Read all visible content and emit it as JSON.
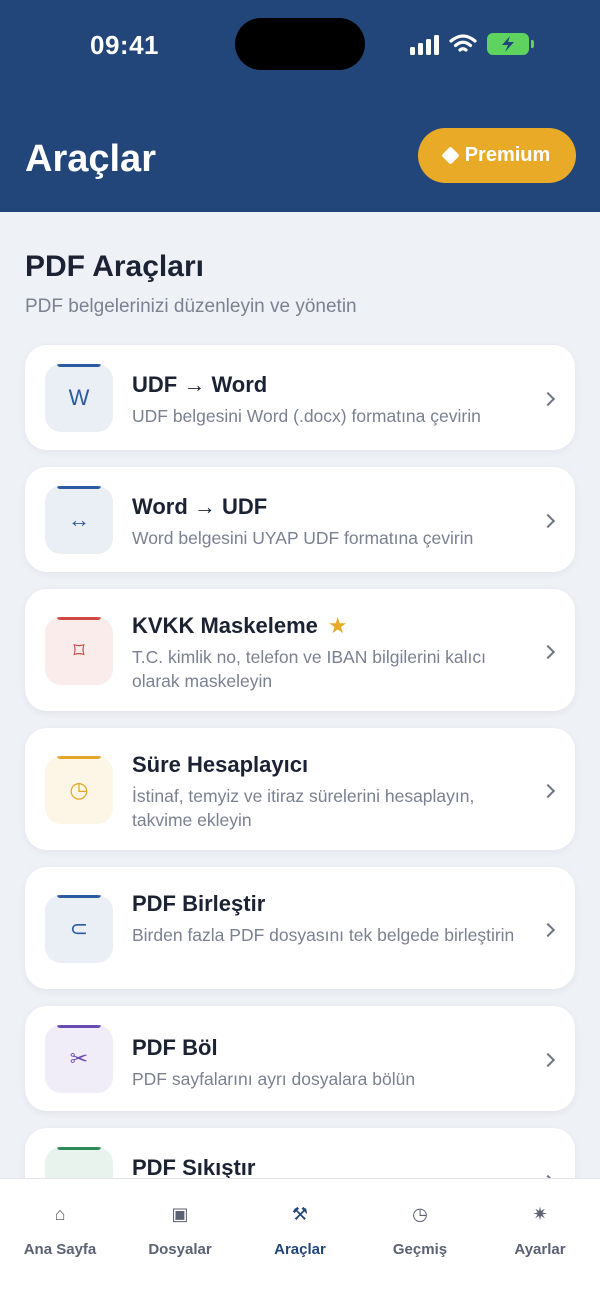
{
  "status_bar": {
    "time": "09:41"
  },
  "header": {
    "title": "Araçlar",
    "premium_label": "Premium"
  },
  "section": {
    "title": "PDF Araçları",
    "subtitle": "PDF belgelerinizi düzenleyin ve yönetin"
  },
  "tools": [
    {
      "title": "UDF → Word",
      "description": "UDF belgesini Word (.docx) formatına çevirin",
      "icon": "word-icon",
      "glyph": "W",
      "accent": "#2c5aa0",
      "icon_bg": "#eaeef5"
    },
    {
      "title": "Word → UDF",
      "description": "Word belgesini UYAP UDF formatına çevirin",
      "icon": "convert-arrows-icon",
      "glyph": "↔",
      "accent": "#2c5aa0",
      "icon_bg": "#eaeef5"
    },
    {
      "title": "KVKK Maskeleme",
      "description": "T.C. kimlik no, telefon ve IBAN bilgilerini kalıcı olarak maskeleyin",
      "icon": "mask-icon",
      "glyph": "⌑",
      "accent": "#d04a43",
      "icon_bg": "#fbecec",
      "starred": true
    },
    {
      "title": "Süre Hesaplayıcı",
      "description": "İstinaf, temyiz ve itiraz sürelerini hesaplayın, takvime ekleyin",
      "icon": "clock-icon",
      "glyph": "◷",
      "accent": "#e3a52a",
      "icon_bg": "#fdf6e6"
    },
    {
      "title": "PDF Birleştir",
      "description": "Birden fazla PDF dosyasını tek belgede birleştirin",
      "icon": "merge-icon",
      "glyph": "⊂",
      "accent": "#2c5aa0",
      "icon_bg": "#eaeef5"
    },
    {
      "title": "PDF Böl",
      "description": "PDF sayfalarını ayrı dosyalara bölün",
      "icon": "scissors-icon",
      "glyph": "✂",
      "accent": "#6a4bb0",
      "icon_bg": "#f0ecf8"
    },
    {
      "title": "PDF Sıkıştır",
      "description": "",
      "icon": "compress-icon",
      "glyph": "▭",
      "accent": "#2f8a5a",
      "icon_bg": "#e8f3ed"
    }
  ],
  "tabbar": {
    "items": [
      {
        "label": "Ana Sayfa",
        "icon": "home-icon",
        "glyph": "⌂"
      },
      {
        "label": "Dosyalar",
        "icon": "folder-icon",
        "glyph": "▣"
      },
      {
        "label": "Araçlar",
        "icon": "tools-icon",
        "glyph": "⚒",
        "active": true
      },
      {
        "label": "Geçmiş",
        "icon": "history-icon",
        "glyph": "◷"
      },
      {
        "label": "Ayarlar",
        "icon": "settings-icon",
        "glyph": "✷"
      }
    ]
  }
}
